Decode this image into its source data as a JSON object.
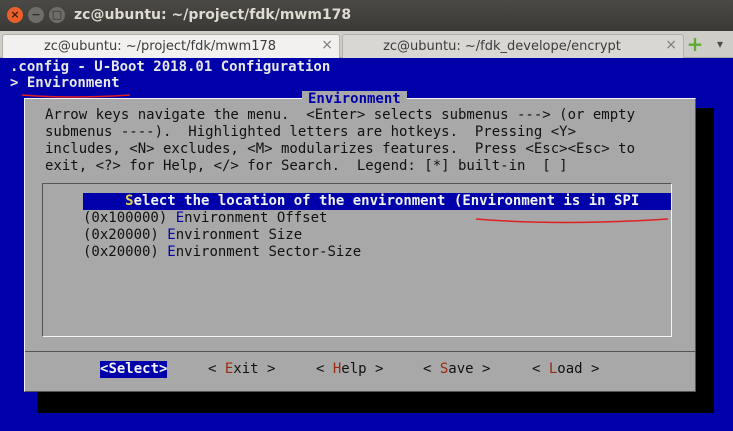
{
  "window": {
    "title": "zc@ubuntu: ~/project/fdk/mwm178",
    "close_glyph": "×",
    "minimize_glyph": "−",
    "maximize_glyph": "□"
  },
  "tabs": [
    {
      "label": "zc@ubuntu: ~/project/fdk/mwm178",
      "close_glyph": "×",
      "active": true
    },
    {
      "label": "zc@ubuntu: ~/fdk_develope/encrypt",
      "close_glyph": "×",
      "active": false
    }
  ],
  "tabbar": {
    "add_glyph": "+",
    "menu_glyph": "▾"
  },
  "terminal": {
    "header_line1": ".config - U-Boot 2018.01 Configuration",
    "header_line2": "> Environment"
  },
  "dialog": {
    "title": "Environment",
    "help_text": "Arrow keys navigate the menu.  <Enter> selects submenus ---> (or empty\nsubmenus ----).  Highlighted letters are hotkeys.  Pressing <Y>\nincludes, <N> excludes, <M> modularizes features.  Press <Esc><Esc> to\nexit, <?> for Help, </> for Search.  Legend: [*] built-in  [ ]",
    "items": [
      {
        "prefix": "     ",
        "hotkey": "S",
        "rest": "elect the location of the environment (Environment is in SPI"
      },
      {
        "prefix": "(0x100000) ",
        "hotkey": "E",
        "rest": "nvironment Offset"
      },
      {
        "prefix": "(0x20000) ",
        "hotkey": "E",
        "rest": "nvironment Size"
      },
      {
        "prefix": "(0x20000) ",
        "hotkey": "E",
        "rest": "nvironment Sector-Size"
      }
    ],
    "buttons": [
      {
        "lead": "<",
        "hotkey": "S",
        "rest": "elect>"
      },
      {
        "lead": "< ",
        "hotkey": "E",
        "rest": "xit >"
      },
      {
        "lead": "< ",
        "hotkey": "H",
        "rest": "elp >"
      },
      {
        "lead": "< ",
        "hotkey": "S",
        "rest": "ave >"
      },
      {
        "lead": "< ",
        "hotkey": "L",
        "rest": "oad >"
      }
    ]
  },
  "colors": {
    "terminal_bg": "#0000aa",
    "dialog_bg": "#a8a8a8",
    "highlight_bg": "#0000aa",
    "hotkey": "#0000aa",
    "button_hotkey": "#9a2a14",
    "annotation": "#e02020"
  }
}
